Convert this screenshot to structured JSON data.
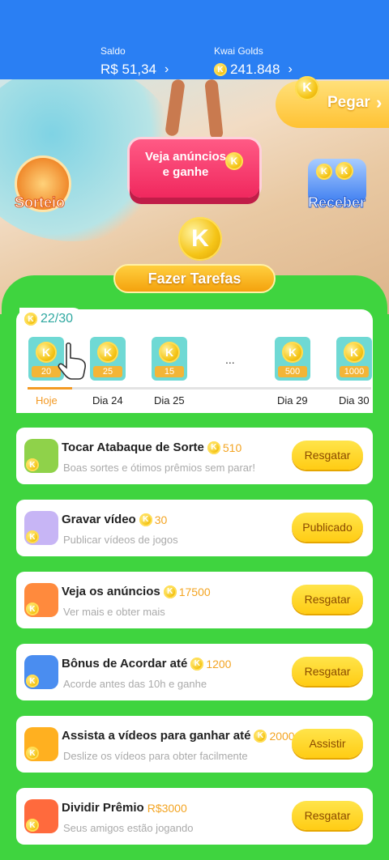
{
  "header": {
    "saldo_label": "Saldo",
    "saldo_value": "R$ 51,34",
    "golds_label": "Kwai Golds",
    "golds_value": "241.848"
  },
  "scene": {
    "pegar_label": "Pegar",
    "veja_label": "Veja anúncios e ganhe",
    "sorteio_label": "Sorteio",
    "receber_label": "Receber",
    "tarefas_label": "Fazer Tarefas",
    "coin_letter": "K"
  },
  "checkin": {
    "count": "22/30",
    "dots": "...",
    "progress": 0.13,
    "days": [
      {
        "amount": "20",
        "label": "Hoje"
      },
      {
        "amount": "25",
        "label": "Dia 24"
      },
      {
        "amount": "15",
        "label": "Dia 25"
      },
      {
        "amount": "500",
        "label": "Dia 29"
      },
      {
        "amount": "1000",
        "label": "Dia 30"
      }
    ]
  },
  "tasks": [
    {
      "title": "Tocar Atabaque de Sorte",
      "reward": "510",
      "subtitle": "Boas sortes e ótimos prêmios sem parar!",
      "button": "Resgatar",
      "icon": "drum-icon"
    },
    {
      "title": "Gravar vídeo",
      "reward": "30",
      "subtitle": "Publicar vídeos de jogos",
      "button": "Publicado",
      "icon": "camera-icon"
    },
    {
      "title": "Veja os anúncios",
      "reward": "17500",
      "subtitle": "Ver mais e obter mais",
      "button": "Resgatar",
      "icon": "tv-icon"
    },
    {
      "title": "Bônus de Acordar até",
      "reward": "1200",
      "subtitle": "Acorde antes das 10h e ganhe",
      "button": "Resgatar",
      "icon": "moon-icon"
    },
    {
      "title": "Assista a vídeos para ganhar até",
      "reward": "2000",
      "subtitle": "Deslize os vídeos para obter facilmente",
      "button": "Assistir",
      "icon": "video-camera-icon"
    },
    {
      "title": "Dividir Prêmio",
      "reward": "R$3000",
      "subtitle": "Seus amigos estão jogando",
      "button": "Resgatar",
      "icon": "gift-icon"
    }
  ]
}
